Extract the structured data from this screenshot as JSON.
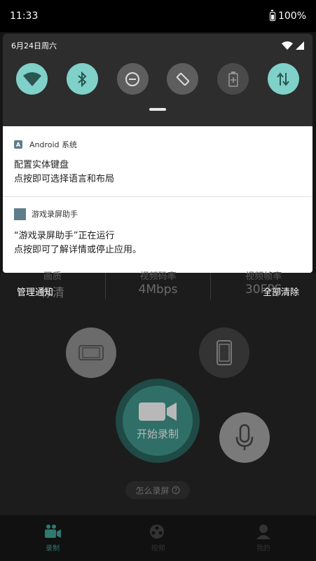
{
  "status_bar": {
    "time": "11:33",
    "battery": "100%"
  },
  "quick_settings": {
    "date": "6月24日周六",
    "tiles": [
      {
        "name": "wifi",
        "state": "on"
      },
      {
        "name": "bluetooth",
        "state": "on"
      },
      {
        "name": "dnd",
        "state": "off"
      },
      {
        "name": "auto-rotate",
        "state": "off"
      },
      {
        "name": "battery-saver",
        "state": "dim"
      },
      {
        "name": "mobile-data",
        "state": "on"
      }
    ]
  },
  "notifications": [
    {
      "app": "Android 系统",
      "title": "配置实体键盘",
      "text": "点按即可选择语言和布局"
    },
    {
      "app": "游戏录屏助手",
      "title": "“游戏录屏助手”正在运行",
      "text": "点按即可了解详情或停止应用。"
    }
  ],
  "actions": {
    "manage": "管理通知",
    "clear_all": "全部清除"
  },
  "app": {
    "stats": [
      {
        "label": "画质",
        "value": "标清"
      },
      {
        "label": "视频码率",
        "value": "4Mbps"
      },
      {
        "label": "视频帧率",
        "value": "30FPS"
      }
    ],
    "record_label": "开始录制",
    "howto": "怎么录屏",
    "nav": [
      {
        "label": "录制",
        "active": true
      },
      {
        "label": "视频",
        "active": false
      },
      {
        "label": "我的",
        "active": false
      }
    ]
  },
  "colors": {
    "accent": "#7fd1c9",
    "record": "#2f6f68"
  }
}
